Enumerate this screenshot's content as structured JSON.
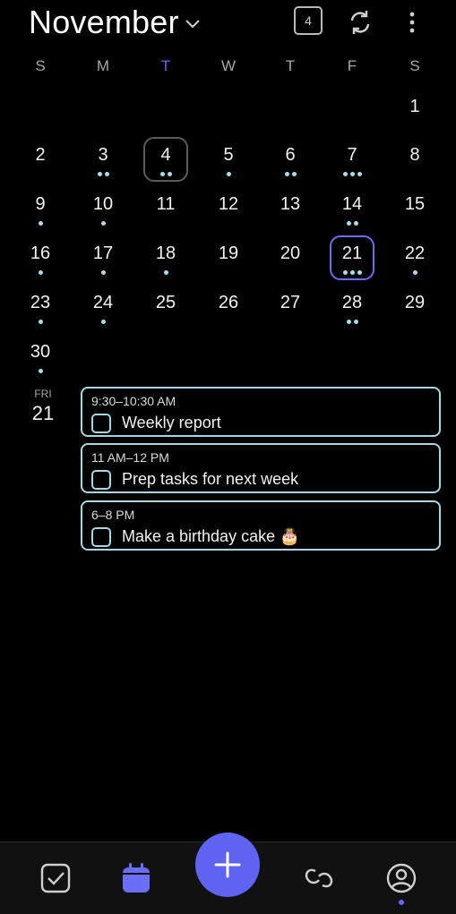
{
  "header": {
    "month": "November",
    "today_badge": "4",
    "icons": {
      "caret": "chevron-down-icon",
      "sync": "sync-icon",
      "more": "more-vertical-icon"
    }
  },
  "weekdays": [
    "S",
    "M",
    "T",
    "W",
    "T",
    "F",
    "S"
  ],
  "calendar": {
    "today": "4",
    "selected": "21",
    "weeks": [
      [
        {
          "d": "",
          "dots": 0
        },
        {
          "d": "",
          "dots": 0
        },
        {
          "d": "",
          "dots": 0
        },
        {
          "d": "",
          "dots": 0
        },
        {
          "d": "",
          "dots": 0
        },
        {
          "d": "",
          "dots": 0
        },
        {
          "d": "1",
          "dots": 0
        }
      ],
      [
        {
          "d": "2",
          "dots": 0
        },
        {
          "d": "3",
          "dots": 2
        },
        {
          "d": "4",
          "dots": 2
        },
        {
          "d": "5",
          "dots": 1
        },
        {
          "d": "6",
          "dots": 2
        },
        {
          "d": "7",
          "dots": 3
        },
        {
          "d": "8",
          "dots": 0
        }
      ],
      [
        {
          "d": "9",
          "dots": 1
        },
        {
          "d": "10",
          "dots": 1
        },
        {
          "d": "11",
          "dots": 0
        },
        {
          "d": "12",
          "dots": 0
        },
        {
          "d": "13",
          "dots": 0
        },
        {
          "d": "14",
          "dots": 2
        },
        {
          "d": "15",
          "dots": 0
        }
      ],
      [
        {
          "d": "16",
          "dots": 1
        },
        {
          "d": "17",
          "dots": 1
        },
        {
          "d": "18",
          "dots": 1
        },
        {
          "d": "19",
          "dots": 0
        },
        {
          "d": "20",
          "dots": 0
        },
        {
          "d": "21",
          "dots": 3
        },
        {
          "d": "22",
          "dots": 1
        }
      ],
      [
        {
          "d": "23",
          "dots": 1
        },
        {
          "d": "24",
          "dots": 1
        },
        {
          "d": "25",
          "dots": 0
        },
        {
          "d": "26",
          "dots": 0
        },
        {
          "d": "27",
          "dots": 0
        },
        {
          "d": "28",
          "dots": 2
        },
        {
          "d": "29",
          "dots": 0
        }
      ],
      [
        {
          "d": "30",
          "dots": 1
        },
        {
          "d": "",
          "dots": 0
        },
        {
          "d": "",
          "dots": 0
        },
        {
          "d": "",
          "dots": 0
        },
        {
          "d": "",
          "dots": 0
        },
        {
          "d": "",
          "dots": 0
        },
        {
          "d": "",
          "dots": 0
        }
      ]
    ]
  },
  "day_detail": {
    "dow": "FRI",
    "date": "21"
  },
  "events": [
    {
      "time": "9:30–10:30 AM",
      "title": "Weekly report"
    },
    {
      "time": "11 AM–12 PM",
      "title": "Prep tasks for next week"
    },
    {
      "time": "6–8 PM",
      "title": "Make a birthday cake 🎂"
    }
  ],
  "colors": {
    "accent": "#5f63f2",
    "dot": "#a7dce8",
    "card_border": "#a4d8e4",
    "background": "#000000"
  },
  "bottom_nav": {
    "items": [
      "tasks-icon",
      "calendar-icon",
      "add-icon",
      "link-icon",
      "profile-icon"
    ],
    "active": "profile"
  }
}
